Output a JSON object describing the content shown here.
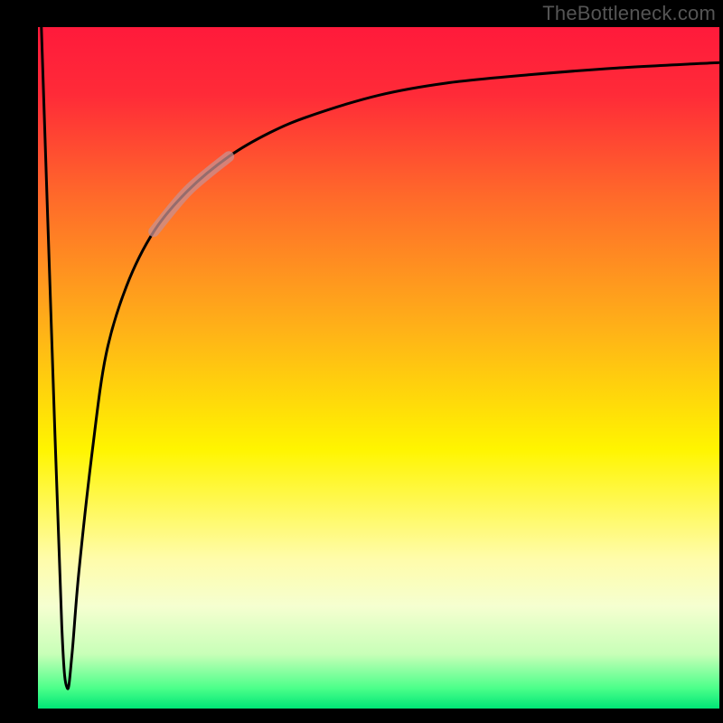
{
  "watermark": "TheBottleneck.com",
  "colors": {
    "frame": "#000000",
    "watermark": "#555555",
    "curve": "#000000",
    "highlight": "#c89090",
    "gradient_stops": [
      {
        "offset": 0.0,
        "color": "#ff1a3b"
      },
      {
        "offset": 0.1,
        "color": "#ff2b38"
      },
      {
        "offset": 0.25,
        "color": "#ff6a2a"
      },
      {
        "offset": 0.45,
        "color": "#ffb417"
      },
      {
        "offset": 0.62,
        "color": "#fff500"
      },
      {
        "offset": 0.78,
        "color": "#fffcaa"
      },
      {
        "offset": 0.85,
        "color": "#f5ffd0"
      },
      {
        "offset": 0.92,
        "color": "#c8ffb8"
      },
      {
        "offset": 0.97,
        "color": "#4cff8a"
      },
      {
        "offset": 1.0,
        "color": "#00e676"
      }
    ]
  },
  "chart_data": {
    "type": "line",
    "title": "",
    "xlabel": "",
    "ylabel": "",
    "xlim": [
      0,
      100
    ],
    "ylim": [
      0,
      100
    ],
    "series": [
      {
        "name": "bottleneck-curve",
        "x": [
          0.5,
          2,
          3.5,
          4.3,
          5,
          6,
          8,
          10,
          13,
          17,
          22,
          28,
          34,
          40,
          50,
          60,
          72,
          85,
          100
        ],
        "values": [
          100,
          55,
          12,
          3,
          8,
          20,
          38,
          52,
          62,
          70,
          76,
          81,
          84.5,
          87,
          90,
          91.8,
          93,
          94,
          94.8
        ]
      }
    ],
    "highlight_segment": {
      "x_start": 17,
      "x_end": 28
    }
  }
}
